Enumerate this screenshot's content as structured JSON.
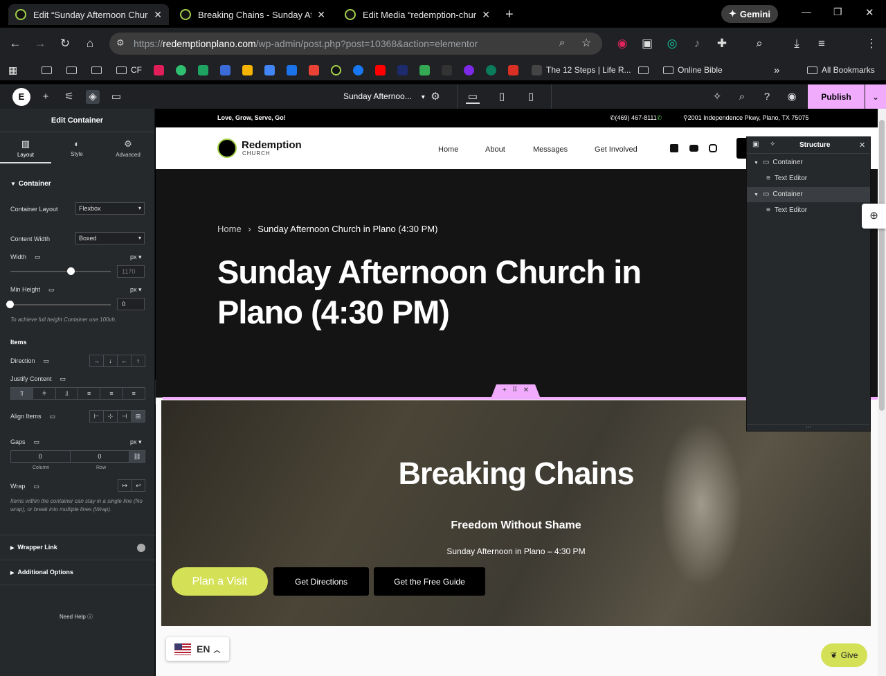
{
  "browser": {
    "tabs": [
      {
        "title": "Edit “Sunday Afternoon Church",
        "active": true
      },
      {
        "title": "Breaking Chains - Sunday After",
        "active": false
      },
      {
        "title": "Edit Media “redemption-church",
        "active": false
      }
    ],
    "gemini_label": "Gemini",
    "url_prefix": "https://",
    "url_domain": "redemptionplano.com",
    "url_path": "/wp-admin/post.php?post=10368&action=elementor",
    "bookmarks": {
      "cf": "CF",
      "twelve_steps": "The 12 Steps | Life R...",
      "online_bible": "Online Bible",
      "all_bookmarks": "All Bookmarks"
    }
  },
  "elementor": {
    "page_selector": "Sunday Afternoo...",
    "publish_label": "Publish",
    "panel": {
      "title": "Edit Container",
      "tabs": [
        "Layout",
        "Style",
        "Advanced"
      ],
      "section_container": "Container",
      "container_layout_label": "Container Layout",
      "container_layout_value": "Flexbox",
      "content_width_label": "Content Width",
      "content_width_value": "Boxed",
      "width_label": "Width",
      "width_unit": "px",
      "width_placeholder": "1170",
      "min_height_label": "Min Height",
      "min_height_unit": "px",
      "min_height_value": "0",
      "min_height_note": "To achieve full height Container use 100vh.",
      "items_label": "Items",
      "direction_label": "Direction",
      "justify_label": "Justify Content",
      "align_label": "Align Items",
      "gaps_label": "Gaps",
      "gaps_unit": "px",
      "gap_column_value": "0",
      "gap_row_value": "0",
      "gap_column_label": "Column",
      "gap_row_label": "Row",
      "wrap_label": "Wrap",
      "wrap_note": "Items within the container can stay in a single line (No wrap), or break into multiple lines (Wrap).",
      "wrapper_link": "Wrapper Link",
      "additional_options": "Additional Options",
      "need_help": "Need Help"
    },
    "structure": {
      "title": "Structure",
      "items": [
        {
          "label": "Container",
          "level": 0
        },
        {
          "label": "Text Editor",
          "level": 1
        },
        {
          "label": "Container",
          "level": 0
        },
        {
          "label": "Text Editor",
          "level": 1
        }
      ]
    }
  },
  "site": {
    "tagline": "Love, Grow, Serve, Go!",
    "phone": "(469) 467-8111",
    "address": "2001 Independence Pkwy, Plano, TX 75075",
    "logo_main": "Redemption",
    "logo_sub": "CHURCH",
    "nav": [
      "Home",
      "About",
      "Messages",
      "Get Involved"
    ],
    "breadcrumb_home": "Home",
    "breadcrumb_current": "Sunday Afternoon Church in Plano (4:30 PM)",
    "hero_title": "Sunday Afternoon Church in Plano (4:30 PM)",
    "section_title": "Breaking Chains",
    "section_subtitle": "Freedom Without Shame",
    "section_time": "Sunday Afternoon in Plano – 4:30 PM",
    "cta": [
      "Plan a Visit",
      "Get Directions",
      "Get the Free Guide"
    ],
    "lang": "EN",
    "give": "Give"
  },
  "colors": {
    "accent": "#f0abfc",
    "cta_green": "#d4e157",
    "panel_bg": "#26292c"
  }
}
